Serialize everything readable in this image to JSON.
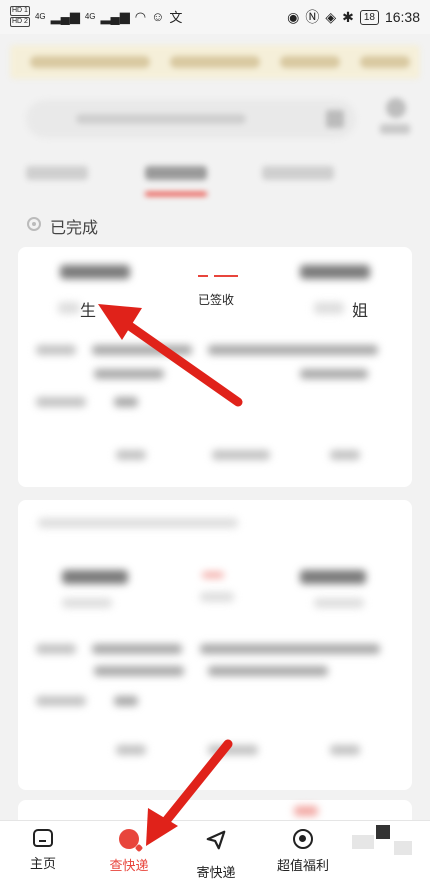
{
  "status_bar": {
    "sim1": "HD 1",
    "sim2": "HD 2",
    "net1": "4G",
    "net2": "4G",
    "battery": "18",
    "time": "16:38"
  },
  "section": {
    "label": "已完成"
  },
  "card1": {
    "status": "已签收",
    "sender_suffix": "生",
    "receiver_suffix": "姐"
  },
  "bottom_nav": {
    "items": [
      {
        "label": "主页",
        "icon": "home-icon",
        "active": false
      },
      {
        "label": "查快递",
        "icon": "query-icon",
        "active": true
      },
      {
        "label": "寄快递",
        "icon": "send-icon",
        "active": false
      },
      {
        "label": "超值福利",
        "icon": "target-icon",
        "active": false
      }
    ]
  },
  "colors": {
    "accent": "#e8453c",
    "annotation_arrow": "#e0221a"
  }
}
